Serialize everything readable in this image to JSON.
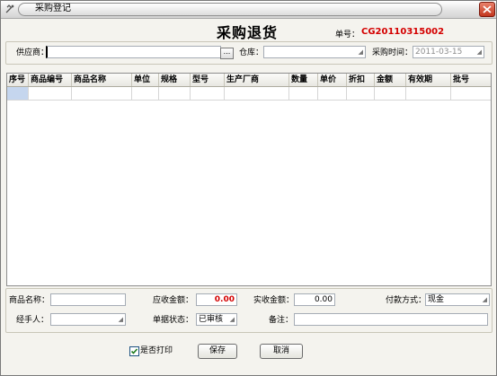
{
  "window": {
    "title": "采购登记"
  },
  "header": {
    "title": "采购退货",
    "order_label": "单号：",
    "order_number": "CG20110315002"
  },
  "top_form": {
    "supplier_label": "供应商：",
    "supplier_value": "",
    "browse_label": "...",
    "warehouse_label": "仓库：",
    "warehouse_value": "",
    "purchase_time_label": "采购时间：",
    "purchase_time_value": "2011-03-15"
  },
  "grid": {
    "columns": [
      "序号",
      "商品编号",
      "商品名称",
      "单位",
      "规格",
      "型号",
      "生产厂商",
      "数量",
      "单价",
      "折扣",
      "金额",
      "有效期",
      "批号"
    ],
    "rows": []
  },
  "bottom_form": {
    "product_name_label": "商品名称：",
    "product_name_value": "",
    "receivable_label": "应收金额：",
    "receivable_value": "0.00",
    "actual_label": "实收金额：",
    "actual_value": "0.00",
    "payment_label": "付款方式：",
    "payment_value": "现金",
    "handler_label": "经手人：",
    "handler_value": "",
    "status_label": "单据状态：",
    "status_value": "已审核",
    "remark_label": "备注：",
    "remark_value": ""
  },
  "footer": {
    "print_label": "是否打印",
    "print_checked": true,
    "save_label": "保存",
    "cancel_label": "取消"
  },
  "colors": {
    "order_number": "#d40000",
    "receivable_value": "#d40000",
    "selected_cell": "#c5d6ee"
  },
  "icons": {
    "app": "app-icon",
    "close": "close-icon",
    "dropdown": "dropdown-arrow-icon",
    "checkbox": "checkbox-check-icon"
  }
}
